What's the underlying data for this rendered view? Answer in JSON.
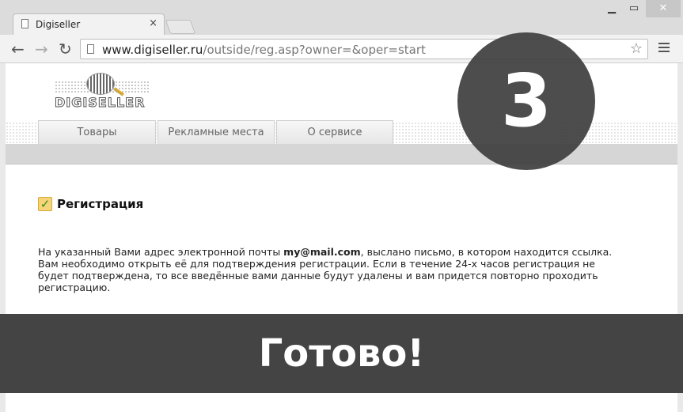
{
  "browser": {
    "tab_title": "Digiseller",
    "tab_close": "×",
    "url_host": "www.digiseller.ru",
    "url_path": "/outside/reg.asp?owner=&oper=start",
    "icons": [
      "back-icon",
      "forward-icon",
      "reload-icon",
      "star-icon",
      "menu-icon",
      "page-icon"
    ]
  },
  "site": {
    "logo_text": "DIGISELLER",
    "nav": [
      "Товары",
      "Рекламные места",
      "О сервисе"
    ]
  },
  "registration": {
    "heading": "Регистрация",
    "msg_before": "На указанный Вами адрес электронной почты ",
    "email": "my@mail.com",
    "msg_after": ", выслано письмо, в котором находится ссылка. Вам необходимо открыть её для подтверждения регистрации. Если в течение 24-х часов регистрация не будет подтверждена, то все введённые вами данные будут удалены и вам придется повторно проходить регистрацию."
  },
  "overlay": {
    "step_number": "3",
    "banner_text": "Готово!"
  }
}
